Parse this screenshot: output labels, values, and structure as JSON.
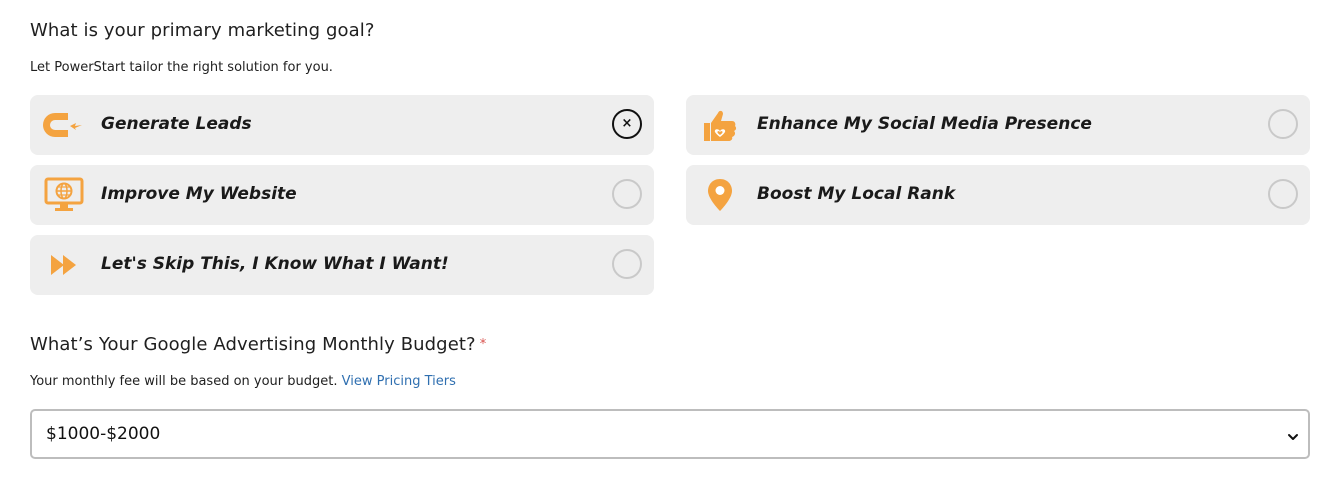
{
  "goal_question": {
    "title": "What is your primary marketing goal?",
    "subtitle": "Let PowerStart tailor the right solution for you."
  },
  "goal_options": [
    {
      "label": "Generate Leads",
      "icon": "magnet-icon",
      "selected": true
    },
    {
      "label": "Enhance My Social Media Presence",
      "icon": "thumbs-up-heart-icon",
      "selected": false
    },
    {
      "label": "Improve My Website",
      "icon": "monitor-globe-icon",
      "selected": false
    },
    {
      "label": "Boost My Local Rank",
      "icon": "map-pin-icon",
      "selected": false
    },
    {
      "label": "Let's Skip This, I Know What I Want!",
      "icon": "fast-forward-icon",
      "selected": false
    }
  ],
  "budget_question": {
    "title": "What’s Your Google Advertising Monthly Budget?",
    "required_mark": "*",
    "subtitle": "Your monthly fee will be based on your budget.",
    "link_text": "View Pricing Tiers"
  },
  "budget_select": {
    "value": "$1000-$2000"
  },
  "colors": {
    "accent": "#f4a340",
    "option_bg": "#eeeeee",
    "link": "#2f6fb0",
    "required": "#d9534f"
  }
}
